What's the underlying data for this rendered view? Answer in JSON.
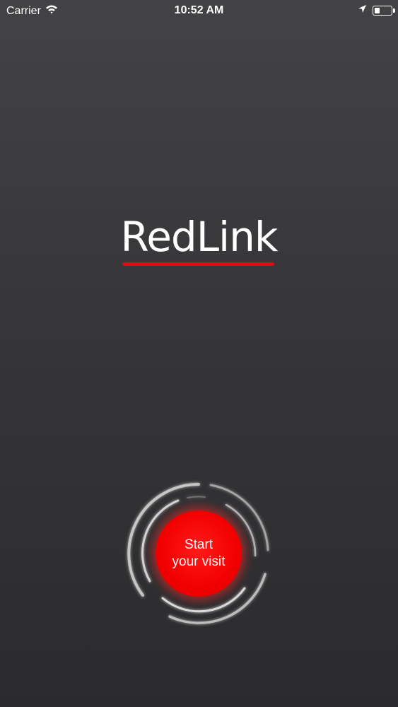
{
  "status_bar": {
    "carrier": "Carrier",
    "time": "10:52 AM",
    "icons": [
      "wifi-icon",
      "location-arrow-icon",
      "battery-icon"
    ],
    "battery_level": 0.3
  },
  "logo": {
    "text": "RedLink",
    "accent_color": "#e30613"
  },
  "start_button": {
    "label": "Start your visit",
    "color": "#f20000"
  },
  "background": {
    "top": "#434345",
    "bottom": "#2b2b2d"
  }
}
